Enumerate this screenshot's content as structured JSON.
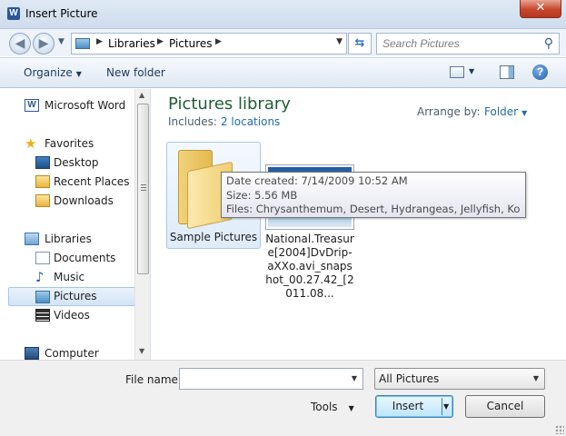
{
  "window": {
    "title": "Insert Picture",
    "app_icon": "W",
    "close_glyph": "✕"
  },
  "address_bar": {
    "crumbs": [
      "Libraries",
      "Pictures"
    ],
    "search_placeholder": "Search Pictures"
  },
  "command_bar": {
    "organize": "Organize",
    "new_folder": "New folder"
  },
  "nav_pane": {
    "items": [
      {
        "label": "Microsoft Word",
        "icon": "word-icon",
        "top": true
      },
      {
        "label": "Favorites",
        "icon": "star-icon",
        "top": true
      },
      {
        "label": "Desktop",
        "icon": "desktop-icon"
      },
      {
        "label": "Recent Places",
        "icon": "recent-places-icon"
      },
      {
        "label": "Downloads",
        "icon": "downloads-icon"
      },
      {
        "label": "Libraries",
        "icon": "libraries-icon",
        "top": true
      },
      {
        "label": "Documents",
        "icon": "documents-icon"
      },
      {
        "label": "Music",
        "icon": "music-icon"
      },
      {
        "label": "Pictures",
        "icon": "pictures-icon",
        "selected": true
      },
      {
        "label": "Videos",
        "icon": "videos-icon"
      },
      {
        "label": "Computer",
        "icon": "computer-icon",
        "top": true
      }
    ]
  },
  "content": {
    "title": "Pictures library",
    "includes_label": "Includes:",
    "includes_link": "2 locations",
    "arrange_label": "Arrange by:",
    "arrange_value": "Folder",
    "folder_tile": {
      "label": "Sample Pictures"
    },
    "file_tile": {
      "label": "National.Treasure[2004]DvDrip-aXXo.avi_snapshot_00.27.42_[2011.08..."
    },
    "tooltip": {
      "date_created": "Date created: 7/14/2009 10:52 AM",
      "size": "Size: 5.56 MB",
      "files": "Files: Chrysanthemum, Desert, Hydrangeas, Jellyfish, Koala, ..."
    }
  },
  "bottom": {
    "file_name_label": "File name:",
    "file_name_value": "",
    "filter_value": "All Pictures",
    "tools_label": "Tools",
    "insert_label": "Insert",
    "cancel_label": "Cancel"
  },
  "colors": {
    "library_title": "#1e5e33",
    "link": "#1f6cb0",
    "selection": "#d3e4f7"
  }
}
